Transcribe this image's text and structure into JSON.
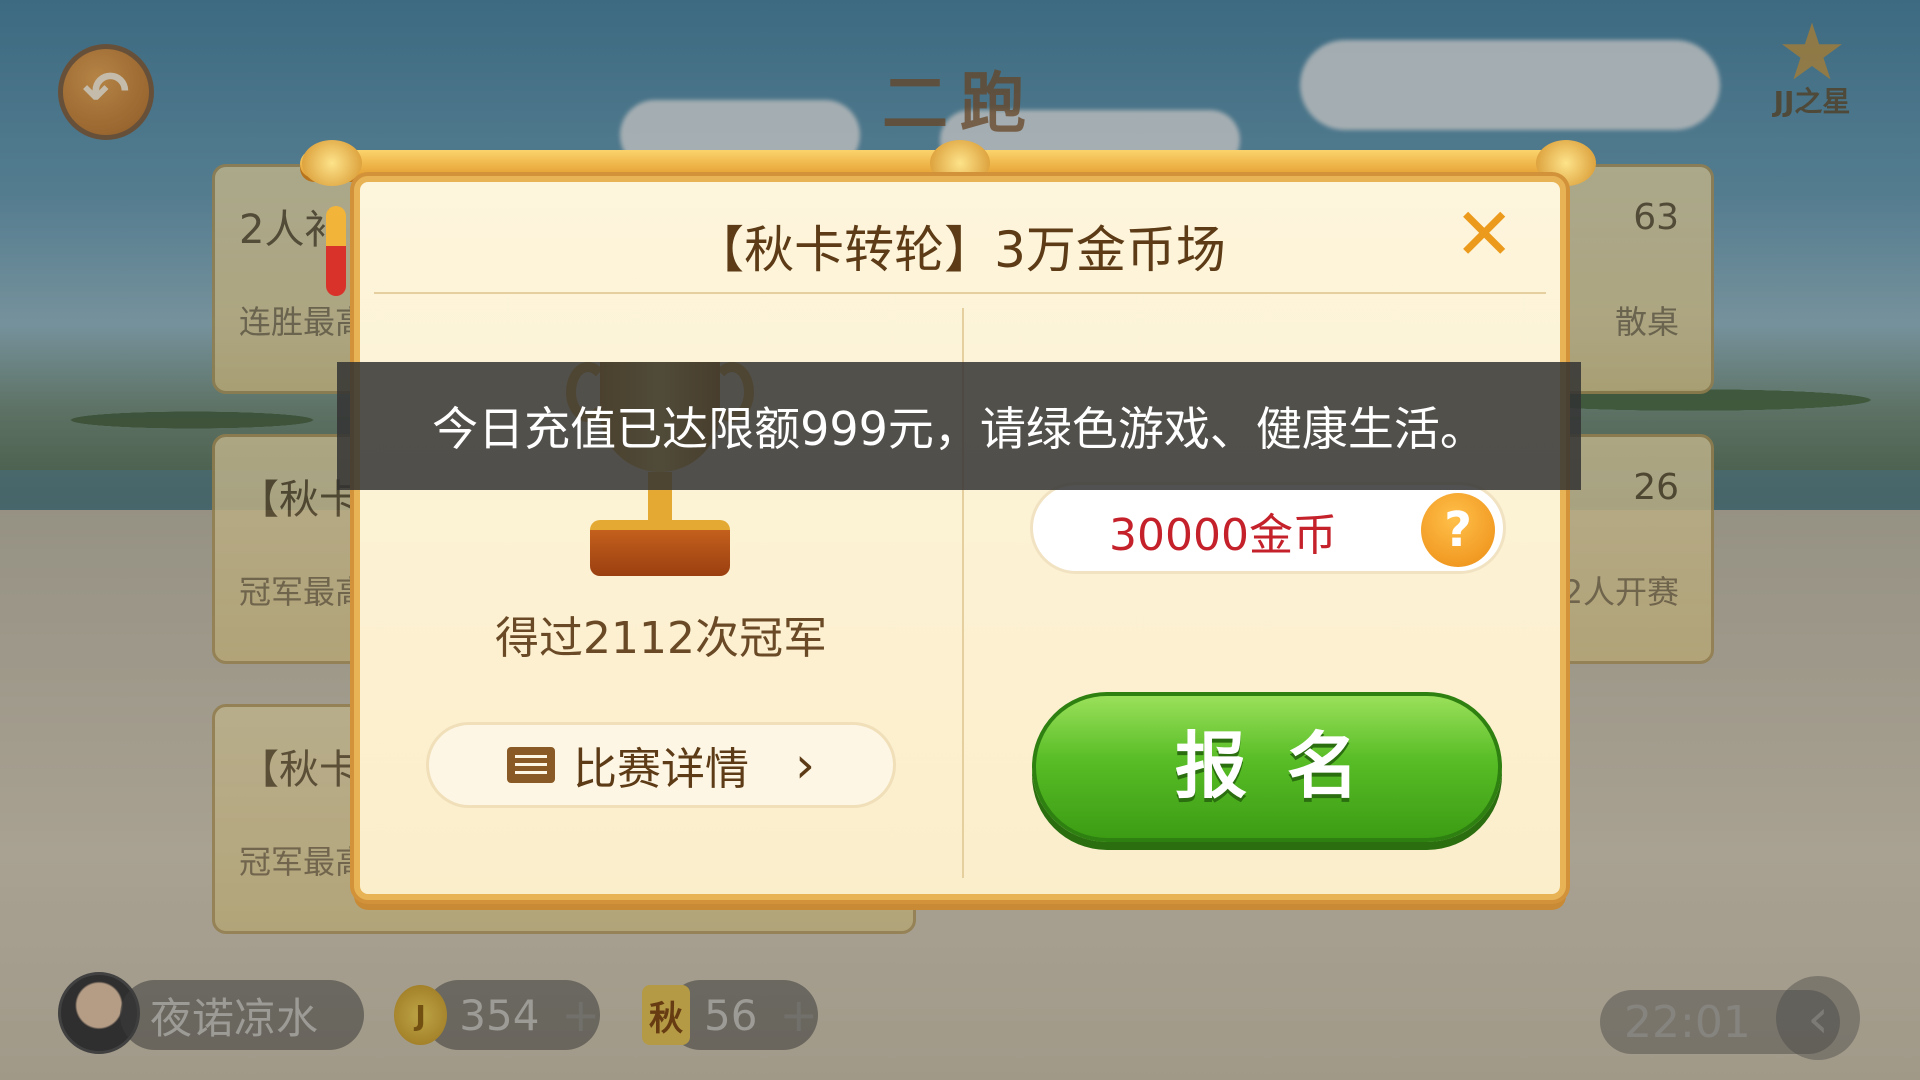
{
  "header": {
    "title": "二跑",
    "badge_label": "JJ之星"
  },
  "rooms": [
    {
      "title": "2人补",
      "subtitle": "连胜最高",
      "right_top": "63",
      "right_bottom": "散桌"
    },
    {
      "title": "【秋卡",
      "subtitle": "冠军最高",
      "right_top": "26",
      "right_bottom": "2人开赛"
    },
    {
      "title": "【秋卡",
      "subtitle": "冠军最高",
      "right_top": "",
      "right_bottom": ""
    }
  ],
  "modal": {
    "title": "【秋卡转轮】3万金币场",
    "champion_text": "得过2112次冠军",
    "details_label": "比赛详情",
    "fee_text": "30000金币",
    "help_label": "?",
    "signup_label": "报名"
  },
  "toast": {
    "message": "今日充值已达限额999元，请绿色游戏、健康生活。"
  },
  "bottom": {
    "username": "夜诺凉水",
    "coins": "354",
    "autumn_label": "秋",
    "autumn_count": "56",
    "time": "22:01"
  },
  "icons": {
    "back": "back-arrow-icon",
    "close": "close-icon",
    "help": "question-icon",
    "trophy": "trophy-icon",
    "document": "document-icon",
    "chevron": "chevron-right-icon",
    "coin": "coin-icon"
  },
  "colors": {
    "accent_gold": "#e8b354",
    "signup_green": "#58bd26",
    "fee_red": "#c4212b",
    "close_orange": "#ec9a1b"
  }
}
